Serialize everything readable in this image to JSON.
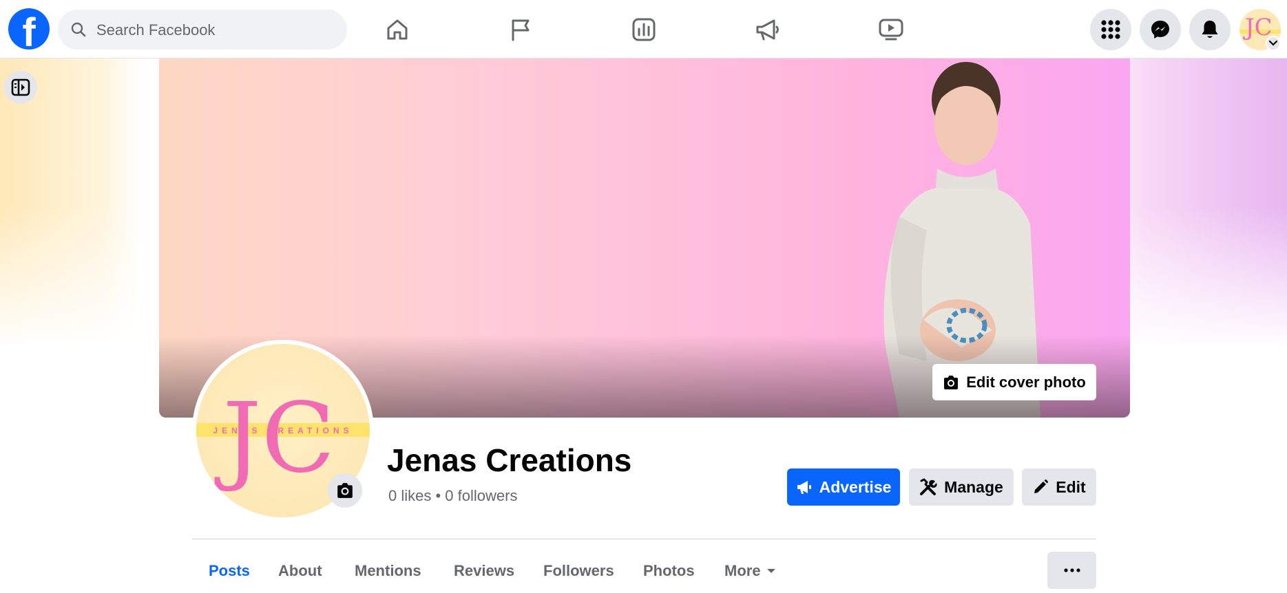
{
  "topbar": {
    "logo_letter": "f",
    "search_placeholder": "Search Facebook",
    "nav_icons": [
      "home-icon",
      "flag-icon",
      "insights-icon",
      "megaphone-icon",
      "video-icon"
    ],
    "right_icons": [
      "menu-grid-icon",
      "messenger-icon",
      "bell-icon"
    ],
    "avatar_text": "JC"
  },
  "cover": {
    "edit_label": "Edit cover photo"
  },
  "profile": {
    "logo_letters": "JC",
    "logo_band_text": "JENAS CREATIONS",
    "name": "Jenas Creations",
    "stats": "0 likes • 0 followers"
  },
  "actions": {
    "advertise": "Advertise",
    "manage": "Manage",
    "edit": "Edit"
  },
  "tabs": [
    {
      "label": "Posts",
      "active": true
    },
    {
      "label": "About"
    },
    {
      "label": "Mentions"
    },
    {
      "label": "Reviews"
    },
    {
      "label": "Followers"
    },
    {
      "label": "Photos"
    },
    {
      "label": "More"
    }
  ],
  "colors": {
    "accent": "#0866ff",
    "button_grey": "#e4e6eb",
    "secondary_text": "#65676b",
    "logo_pink": "#f06bb4",
    "logo_band": "#fde36b"
  }
}
